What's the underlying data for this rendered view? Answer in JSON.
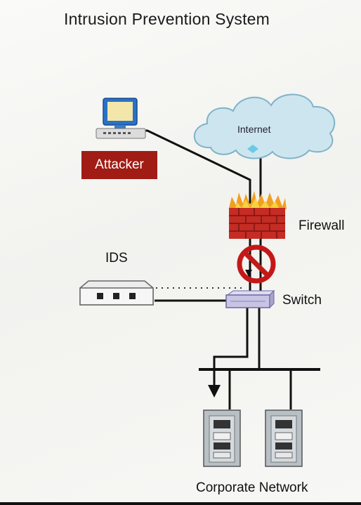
{
  "title": "Intrusion Prevention System",
  "nodes": {
    "attacker": "Attacker",
    "internet": "Internet",
    "firewall": "Firewall",
    "ids": "IDS",
    "switch": "Switch",
    "network": "Corporate Network"
  },
  "colors": {
    "attacker_box": "#a01c14",
    "cloud": "#cfe6f0",
    "firewall_brick": "#c42c24",
    "blocked_sign": "#c41818",
    "switch": "#c8c4e4"
  }
}
